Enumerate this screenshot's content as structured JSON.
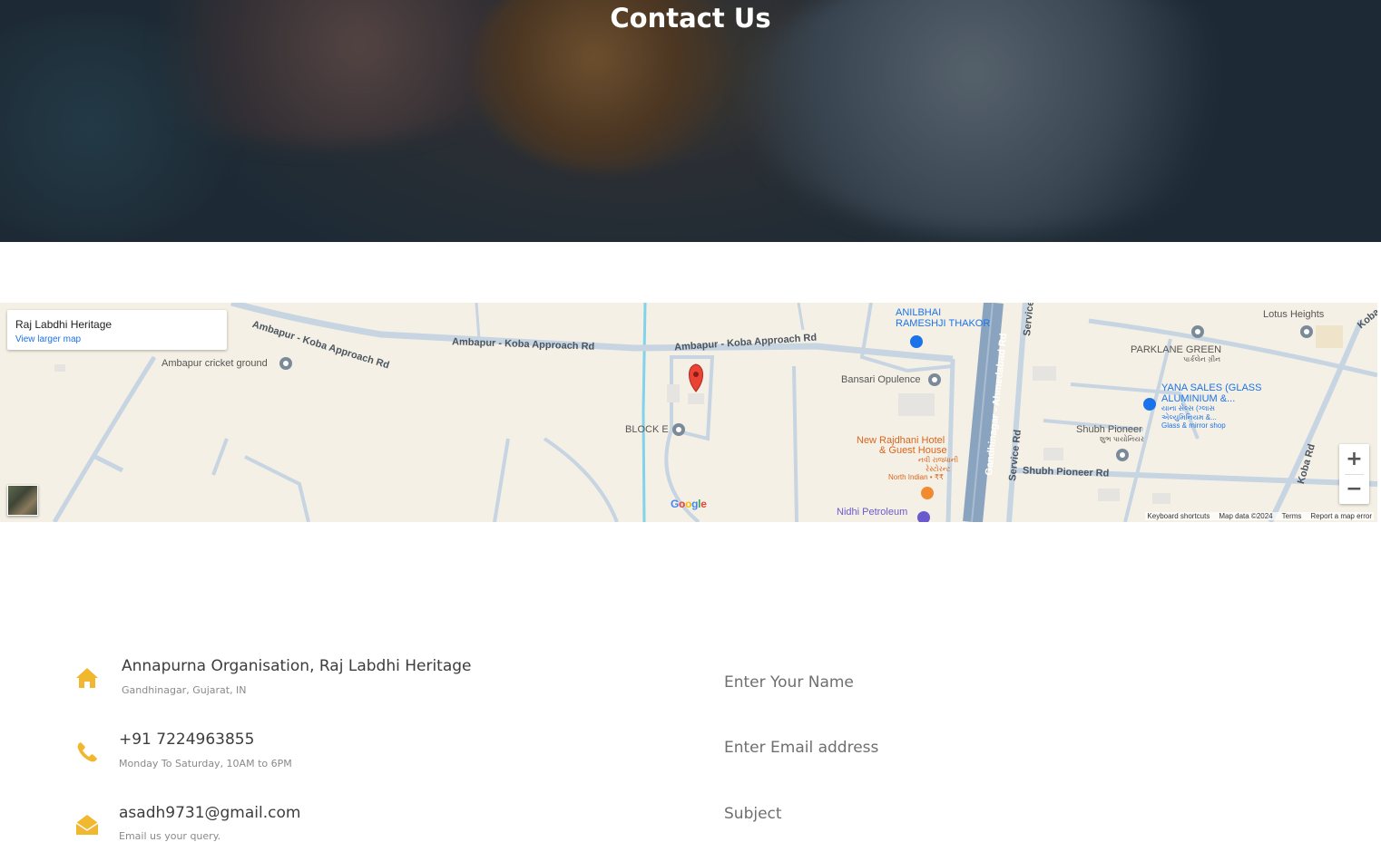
{
  "hero": {
    "title": "Contact Us"
  },
  "map": {
    "place_name": "Raj Labdhi Heritage",
    "view_larger_link": "View larger map",
    "labels": {
      "road_1a": "Ambapur - Koba Approach Rd",
      "road_1b": "Ambapur - Koba Approach Rd",
      "road_1c": "Ambapur - Koba Approach Rd",
      "cricket": "Ambapur cricket ground",
      "block_e": "BLOCK E",
      "anilbhai_1": "ANILBHAI",
      "anilbhai_2": "RAMESHJI THAKOR",
      "bansari": "Bansari Opulence",
      "rajdhani_1": "New Rajdhani Hotel",
      "rajdhani_2": "& Guest House",
      "rajdhani_3": "નવી રાજધાની",
      "rajdhani_4": "રેસ્ટોરન્ટ",
      "rajdhani_5": "North Indian • ₹₹",
      "nidhi": "Nidhi Petroleum",
      "gandhinagar_rd": "Gandhinagar - Ahmedabad Rd",
      "service_rd_1": "Service Rd",
      "service_rd_2": "Service",
      "shubh_pioneer": "Shubh Pioneer",
      "shubh_pioneer_gu": "શુભ પાયોનિયર",
      "shubh_pioneer_rd": "Shubh Pioneer Rd",
      "parklane": "PARKLANE GREEN",
      "parklane_gu": "પાર્કલેન ગ્રીન",
      "yana_1": "YANA SALES (GLASS",
      "yana_2": "ALUMINIUM &...",
      "yana_3": "યાના સેલ્સ (ગ્લાસ",
      "yana_4": "એલ્યુમિનિયમ &...",
      "yana_5": "Glass & mirror shop",
      "lotus": "Lotus Heights",
      "koba_rd_1": "Koba Rd",
      "koba_rd_2": "Koba"
    },
    "google_logo": "Google",
    "zoom_in": "+",
    "zoom_out": "−",
    "footer": {
      "shortcuts": "Keyboard shortcuts",
      "data": "Map data ©2024",
      "terms": "Terms",
      "report": "Report a map error"
    },
    "colors": {
      "land": "#f5f0e5",
      "road": "#c7d4e2",
      "highway": "#8aa4c0",
      "water": "#7fd3ea",
      "pin": "#ea4335"
    }
  },
  "contact": {
    "accent_color": "#f0b72f",
    "items": [
      {
        "icon": "home-icon",
        "title": "Annapurna Organisation, Raj Labdhi Heritage",
        "subtitle": "Gandhinagar, Gujarat, IN"
      },
      {
        "icon": "phone-icon",
        "title": "+91 7224963855",
        "subtitle": "Monday To Saturday, 10AM to 6PM"
      },
      {
        "icon": "envelope-open-icon",
        "title": "asadh9731@gmail.com",
        "subtitle": "Email us your query."
      }
    ]
  },
  "form": {
    "name_placeholder": "Enter Your Name",
    "email_placeholder": "Enter Email address",
    "subject_placeholder": "Subject"
  }
}
